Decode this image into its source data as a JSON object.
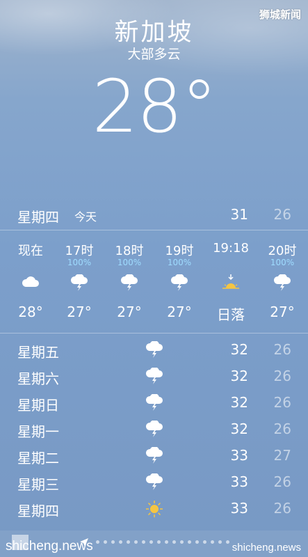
{
  "watermark": "狮城新闻",
  "city": "新加坡",
  "condition": "大部多云",
  "current_temp": "28°",
  "today": {
    "day": "星期四",
    "tag": "今天",
    "hi": "31",
    "lo": "26"
  },
  "hourly": [
    {
      "label": "现在",
      "precip": "",
      "icon": "cloud-icon",
      "temp": "28°"
    },
    {
      "label": "17时",
      "precip": "100%",
      "icon": "thunderstorm-icon",
      "temp": "27°"
    },
    {
      "label": "18时",
      "precip": "100%",
      "icon": "thunderstorm-icon",
      "temp": "27°"
    },
    {
      "label": "19时",
      "precip": "100%",
      "icon": "thunderstorm-icon",
      "temp": "27°"
    },
    {
      "label": "19:18",
      "precip": "",
      "icon": "sunset-icon",
      "temp": "日落"
    },
    {
      "label": "20时",
      "precip": "100%",
      "icon": "thunderstorm-icon",
      "temp": "27°"
    }
  ],
  "daily": [
    {
      "day": "星期五",
      "icon": "thunderstorm-icon",
      "hi": "32",
      "lo": "26"
    },
    {
      "day": "星期六",
      "icon": "thunderstorm-icon",
      "hi": "32",
      "lo": "26"
    },
    {
      "day": "星期日",
      "icon": "thunderstorm-icon",
      "hi": "32",
      "lo": "26"
    },
    {
      "day": "星期一",
      "icon": "thunderstorm-icon",
      "hi": "32",
      "lo": "26"
    },
    {
      "day": "星期二",
      "icon": "thunderstorm-icon",
      "hi": "33",
      "lo": "27"
    },
    {
      "day": "星期三",
      "icon": "thunderstorm-icon",
      "hi": "33",
      "lo": "26"
    },
    {
      "day": "星期四",
      "icon": "sun-icon",
      "hi": "33",
      "lo": "26"
    }
  ],
  "footer": {
    "brand_left": "shicheng.news",
    "brand_right": "shicheng.news"
  },
  "colors": {
    "precip": "#9fdcff",
    "sun": "#f5c542"
  }
}
